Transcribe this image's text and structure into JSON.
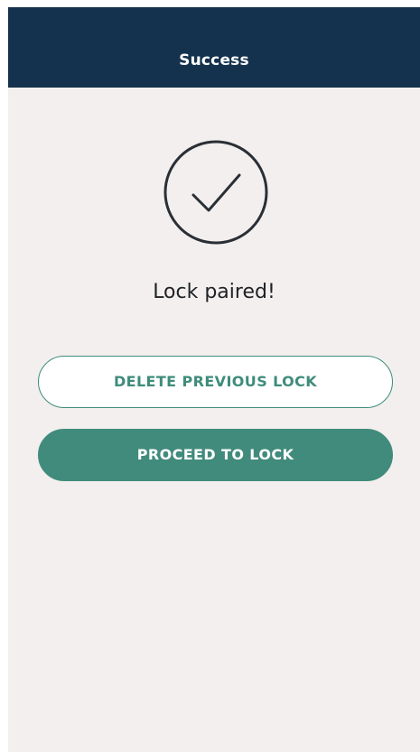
{
  "header": {
    "title": "Success"
  },
  "status": {
    "icon": "checkmark-circle-icon",
    "message": "Lock paired!"
  },
  "actions": {
    "delete_previous_label": "DELETE PREVIOUS LOCK",
    "proceed_label": "PROCEED TO LOCK"
  },
  "colors": {
    "header_background": "#14324d",
    "page_background": "#f3efee",
    "accent": "#418b7c",
    "text_dark": "#1f2126"
  }
}
